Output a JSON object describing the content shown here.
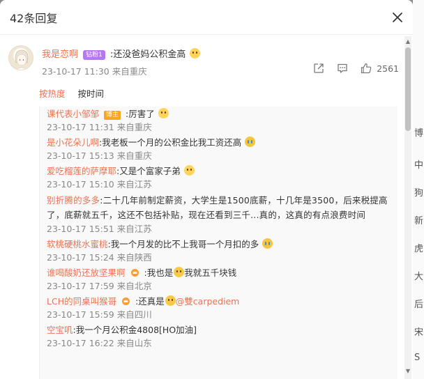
{
  "modal": {
    "title": "42条回复"
  },
  "backdrop": {
    "glyphs": [
      "博",
      "中",
      "狗",
      "新",
      "虎",
      "大",
      "后",
      "宋",
      "S"
    ]
  },
  "main_comment": {
    "username": "我是恋啊",
    "vip_badge": "钻粉1",
    "text": ":还没爸妈公积金高",
    "meta": "23-10-17 11:30 来自重庆",
    "like_count": "2561"
  },
  "sort": {
    "hot_label": "按热度",
    "time_label": "按时间"
  },
  "replies": [
    {
      "username": "课代表小邹邹",
      "badge": "博主",
      "text": ":厉害了",
      "emoji": "shy",
      "meta": "23-10-17 11:31 来自重庆"
    },
    {
      "username": "是小花朵儿啊",
      "text": ":我老板一个月的公积金比我工资还高",
      "emoji": "cry",
      "meta": "23-10-17 15:13 来自重庆"
    },
    {
      "username": "爱吃榴莲的萨摩耶",
      "text": ":又是个富家子弟",
      "emoji": "shy",
      "meta": "23-10-17 15:10 来自江苏"
    },
    {
      "username": "别折腾的多多",
      "text": ":二十几年前制定薪资，大学生是1500底薪，十几年是3500，后来税提高了，底薪就五千，这还不包括补贴，现在还看到三千...真的，这真的有点浪费时间",
      "meta": "23-10-17 15:51 来自江苏"
    },
    {
      "username": "软桃硬桃水蜜桃",
      "text": ":我一个月发的比不上我哥一个月扣的多",
      "emoji": "cry",
      "meta": "23-10-17 15:24 来自陕西"
    },
    {
      "username": "谁喝酸奶还放坚果啊",
      "crown": true,
      "text_before": ":我也是",
      "text": "我就五千块钱",
      "emoji": "smirk",
      "meta": "23-10-17 17:59 来自北京"
    },
    {
      "username": "LCH的同桌叫猴哥",
      "crown": true,
      "text_before": ":还真是",
      "mention": "@雙carpediem",
      "emoji": "smirk",
      "meta": "23-10-17 15:59 来自四川"
    },
    {
      "username": "空宝叽",
      "text": ":我一个月公积金4808[HO加油]",
      "meta": "23-10-17 16:22 来自山东"
    }
  ]
}
